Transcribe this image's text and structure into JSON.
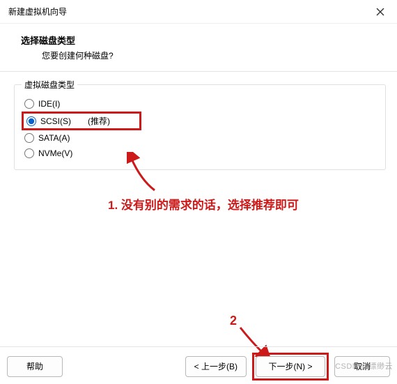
{
  "window": {
    "title": "新建虚拟机向导"
  },
  "header": {
    "title": "选择磁盘类型",
    "subtitle": "您要创建何种磁盘?"
  },
  "group": {
    "legend": "虚拟磁盘类型",
    "options": {
      "ide": "IDE(I)",
      "scsi": "SCSI(S)",
      "scsi_reco": "(推荐)",
      "sata": "SATA(A)",
      "nvme": "NVMe(V)"
    }
  },
  "annotations": {
    "note1": "1. 没有别的需求的话，选择推荐即可",
    "note2": "2"
  },
  "footer": {
    "help": "帮助",
    "back": "< 上一步(B)",
    "next": "下一步(N) >",
    "cancel": "取消"
  },
  "watermark": "CSDN @缥缈云"
}
